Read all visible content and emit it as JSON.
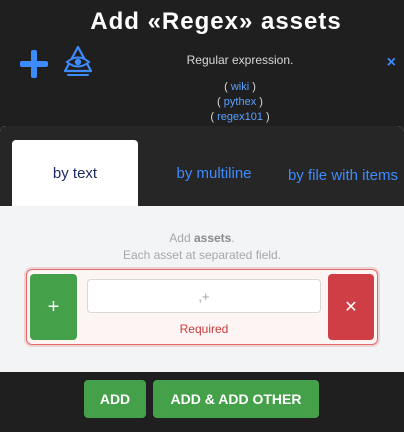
{
  "header": {
    "title": "Add «Regex» assets",
    "description": "Regular expression.",
    "close_label": "×"
  },
  "links": [
    {
      "open": "( ",
      "label": "wiki",
      "close": " )"
    },
    {
      "open": "( ",
      "label": "pythex",
      "close": " )"
    },
    {
      "open": "( ",
      "label": "regex101",
      "close": " )"
    }
  ],
  "tabs": [
    {
      "label": "by text",
      "active": true
    },
    {
      "label": "by multiline",
      "active": false
    },
    {
      "label": "by file with items",
      "active": false
    }
  ],
  "form": {
    "hint_prefix": "Add ",
    "hint_bold": "assets",
    "hint_suffix": ".",
    "hint_line2": "Each asset at separated field.",
    "add_field_label": "+",
    "input_value": "",
    "input_placeholder": ",+",
    "validation": "Required",
    "remove_field_label": "✕"
  },
  "footer": {
    "add_label": "ADD",
    "add_other_label": "ADD & ADD OTHER"
  },
  "colors": {
    "accent": "#3d8bff",
    "success": "#45a04a",
    "danger": "#cf3d45",
    "background": "#1f1f1f"
  },
  "icons": [
    "plus-icon",
    "eye-pyramid-icon",
    "close-icon"
  ]
}
